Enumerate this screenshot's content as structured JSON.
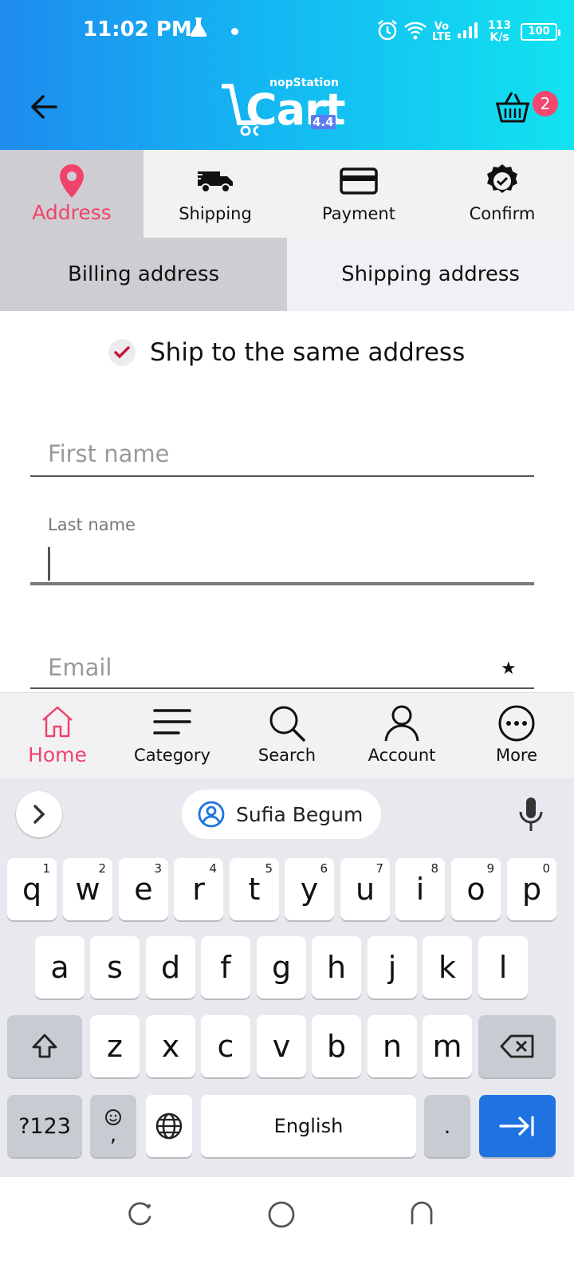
{
  "status_bar": {
    "time": "11:02 PM",
    "network_vo": "Vo",
    "network_lte": "LTE",
    "speed_value": "113",
    "speed_unit": "K/s",
    "battery": "100"
  },
  "header": {
    "brand": "nopStation",
    "logo_word": "Cart",
    "logo_version": "4.4",
    "cart_count": "2",
    "gradient_start": "#1e8bf0",
    "gradient_end": "#12e3ef"
  },
  "checkout_steps": [
    {
      "label": "Address",
      "icon": "location-pin-icon",
      "active": true
    },
    {
      "label": "Shipping",
      "icon": "truck-icon",
      "active": false
    },
    {
      "label": "Payment",
      "icon": "credit-card-icon",
      "active": false
    },
    {
      "label": "Confirm",
      "icon": "check-badge-icon",
      "active": false
    }
  ],
  "address_tabs": {
    "billing": "Billing address",
    "shipping": "Shipping address",
    "selected": "billing"
  },
  "form": {
    "ship_same_label": "Ship to the same address",
    "ship_same_checked": true,
    "first_name_placeholder": "First name",
    "last_name_label": "Last name",
    "last_name_value": "",
    "email_placeholder": "Email",
    "required_marker": "★"
  },
  "bottom_nav": [
    {
      "label": "Home",
      "icon": "home-icon",
      "active": true
    },
    {
      "label": "Category",
      "icon": "menu-icon",
      "active": false
    },
    {
      "label": "Search",
      "icon": "search-icon",
      "active": false
    },
    {
      "label": "Account",
      "icon": "user-icon",
      "active": false
    },
    {
      "label": "More",
      "icon": "more-icon",
      "active": false
    }
  ],
  "keyboard": {
    "suggestion": "Sufia Begum",
    "row1": [
      "q",
      "w",
      "e",
      "r",
      "t",
      "y",
      "u",
      "i",
      "o",
      "p"
    ],
    "row1_numbers": [
      "1",
      "2",
      "3",
      "4",
      "5",
      "6",
      "7",
      "8",
      "9",
      "0"
    ],
    "row2": [
      "a",
      "s",
      "d",
      "f",
      "g",
      "h",
      "j",
      "k",
      "l"
    ],
    "row3": [
      "z",
      "x",
      "c",
      "v",
      "b",
      "n",
      "m"
    ],
    "symbols_key": "?123",
    "comma_key": ",",
    "space_label": "English",
    "period_key": "."
  },
  "colors": {
    "accent": "#f0436c",
    "enter_key": "#1f73e0",
    "active_tab_bg": "#cfcdd2"
  }
}
